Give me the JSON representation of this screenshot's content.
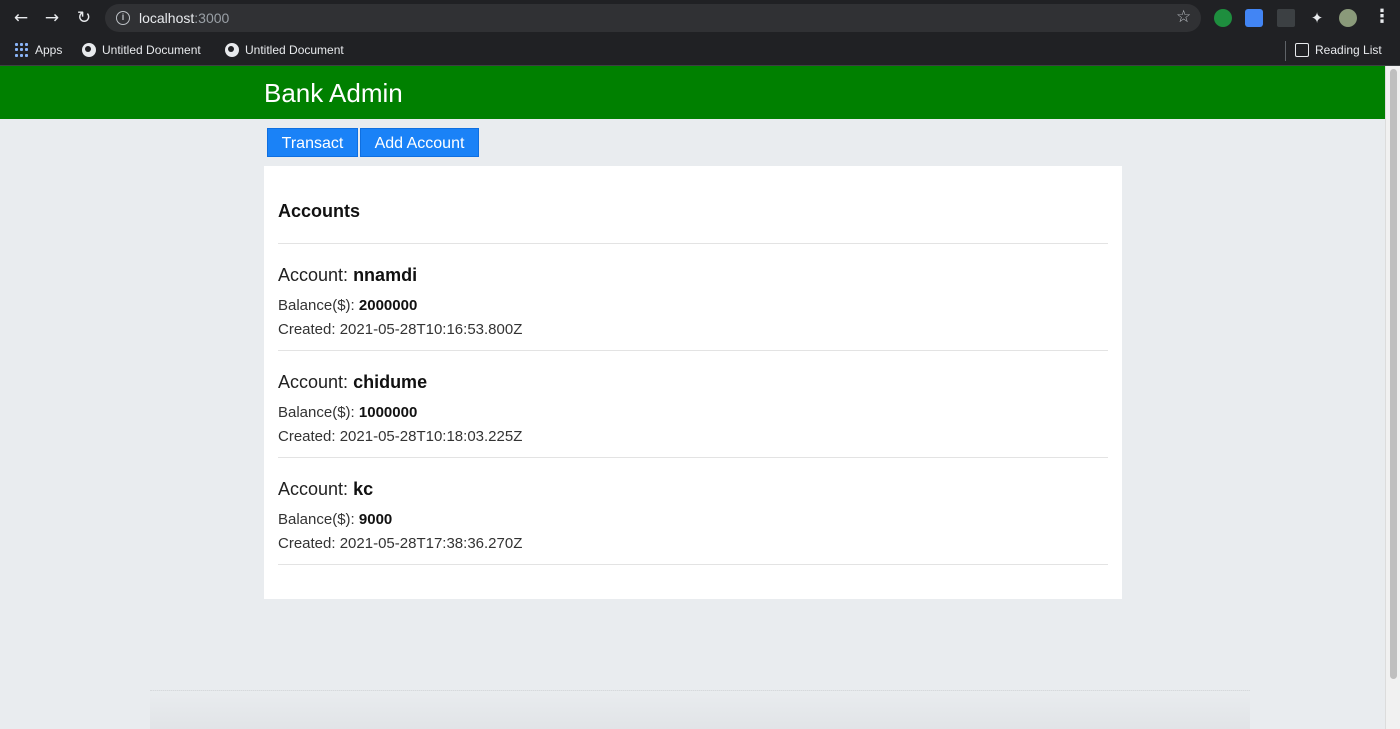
{
  "browser": {
    "url_host": "localhost",
    "url_port": ":3000",
    "bookmarks": [
      "Apps",
      "Untitled Document",
      "Untitled Document"
    ],
    "reading_list": "Reading List"
  },
  "header": {
    "title": "Bank Admin"
  },
  "actions": {
    "transact_label": "Transact",
    "add_account_label": "Add Account"
  },
  "accounts_panel": {
    "title": "Accounts",
    "account_prefix": "Account:",
    "balance_prefix": "Balance($):",
    "created_prefix": "Created:",
    "accounts": [
      {
        "name": "nnamdi",
        "balance": "2000000",
        "created": "2021-05-28T10:16:53.800Z"
      },
      {
        "name": "chidume",
        "balance": "1000000",
        "created": "2021-05-28T10:18:03.225Z"
      },
      {
        "name": "kc",
        "balance": "9000",
        "created": "2021-05-28T17:38:36.270Z"
      }
    ]
  },
  "colors": {
    "header_bg": "#008000",
    "button_bg": "#1a82f7",
    "page_bg": "#e9ecef"
  }
}
